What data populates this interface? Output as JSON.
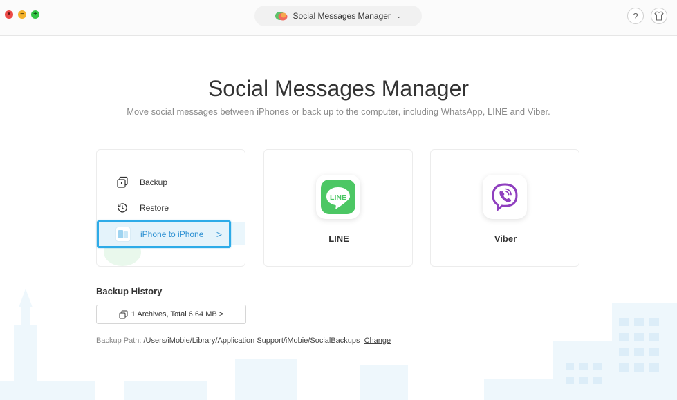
{
  "titlebar": {
    "app_switch_label": "Social Messages Manager",
    "help_symbol": "?",
    "icons": [
      "close-icon",
      "minimize-icon",
      "maximize-icon",
      "messages-logo-icon",
      "chevron-down-icon",
      "help-icon",
      "tshirt-skin-icon"
    ]
  },
  "main": {
    "title": "Social Messages Manager",
    "subtitle": "Move social messages between iPhones or back up to the computer, including WhatsApp, LINE and Viber."
  },
  "whatsapp_card": {
    "menu": [
      {
        "label": "Backup",
        "icon": "backup-icon"
      },
      {
        "label": "Restore",
        "icon": "restore-history-icon"
      },
      {
        "label": "iPhone to iPhone",
        "icon": "iphone-to-iphone-icon",
        "selected": true
      }
    ]
  },
  "line_card": {
    "name": "LINE",
    "logo_text": "LINE",
    "icon": "line-logo-icon",
    "color": "#4cc764"
  },
  "viber_card": {
    "name": "Viber",
    "icon": "viber-logo-icon",
    "color": "#8f3fbf"
  },
  "backup_history": {
    "title": "Backup History",
    "archives_label": "1 Archives, Total  6.64 MB >",
    "path_label": "Backup Path:",
    "path_value": "/Users/iMobie/Library/Application Support/iMobie/SocialBackups",
    "change_label": "Change"
  },
  "colors": {
    "accent": "#2dabe8",
    "selected_bg": "#e4f3fb",
    "city_bg": "#eaf5fb"
  }
}
